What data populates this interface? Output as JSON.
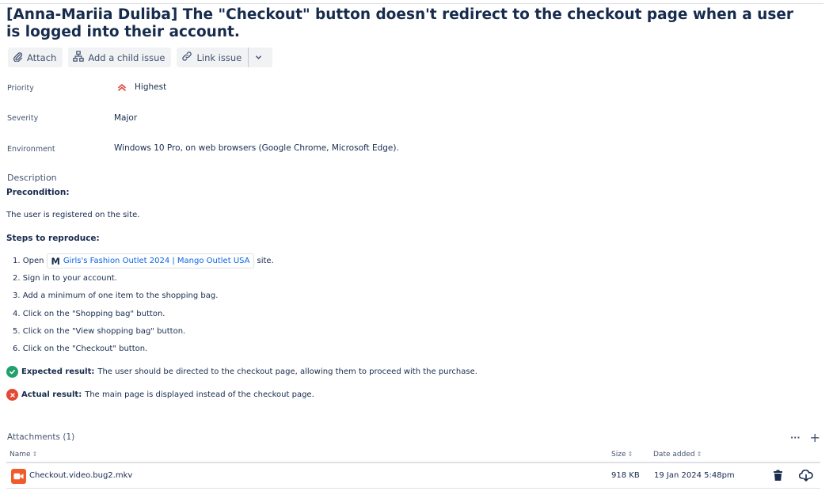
{
  "issue": {
    "title": "[Anna-Mariia Duliba] The \"Checkout\" button doesn't redirect to the checkout page when a user is logged into their account."
  },
  "toolbar": {
    "attach_label": "Attach",
    "add_child_label": "Add a child issue",
    "link_issue_label": "Link issue"
  },
  "fields": {
    "priority": {
      "label": "Priority",
      "value": "Highest",
      "icon": "highest-priority-icon",
      "color": "#e2483d"
    },
    "severity": {
      "label": "Severity",
      "value": "Major"
    },
    "environment": {
      "label": "Environment",
      "value": "Windows 10 Pro, on web browsers (Google Chrome, Microsoft Edge)."
    }
  },
  "description": {
    "label": "Description",
    "precondition_heading": "Precondition:",
    "precondition_text": "The user is registered on the site.",
    "steps_heading": "Steps to reproduce:",
    "steps": [
      {
        "prefix": "1. Open",
        "link_icon": "M",
        "link_text": "Girls's Fashion Outlet 2024 | Mango Outlet USA",
        "suffix": "site."
      },
      {
        "text": "2. Sign in to your account."
      },
      {
        "text": "3. Add a minimum of one item to the shopping bag."
      },
      {
        "text": "4. Click on the \"Shopping bag\" button."
      },
      {
        "text": "5. Click on the \"View shopping bag\" button."
      },
      {
        "text": "6. Click on the \"Checkout\" button."
      }
    ],
    "expected_label": "Expected result:",
    "expected_text": "The user should be directed to the checkout page, allowing them to proceed with the purchase.",
    "actual_label": "Actual result:",
    "actual_text": "The main page is displayed instead of the checkout page.",
    "expected_color": "#22a06b",
    "actual_color": "#e34935"
  },
  "attachments": {
    "title": "Attachments (1)",
    "more_label": "···",
    "add_label": "+",
    "columns": {
      "name": "Name",
      "size": "Size",
      "date": "Date added"
    },
    "sort_glyph": "⇕",
    "rows": [
      {
        "name": "Checkout.video.bug2.mkv",
        "size": "918 KB",
        "date": "19 Jan 2024 5:48pm",
        "icon": "video-file-icon",
        "icon_color": "#f15b2a"
      }
    ]
  }
}
